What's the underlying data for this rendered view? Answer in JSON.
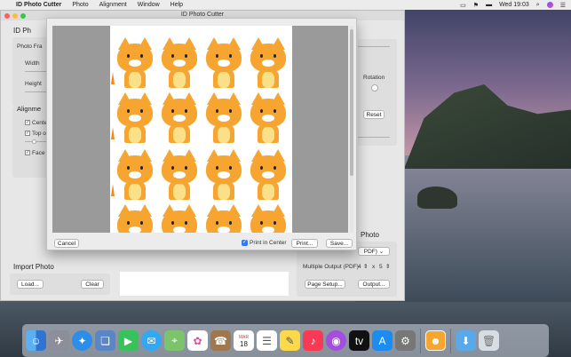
{
  "menubar": {
    "apple": "",
    "app_name": "ID Photo Cutter",
    "items": [
      "Photo",
      "Alignment",
      "Window",
      "Help"
    ],
    "clock": "Wed 19:03"
  },
  "window": {
    "title": "ID Photo Cutter",
    "left_title": "ID Ph",
    "photo_frame": "Photo Fra",
    "width_label": "Width",
    "height_label": "Height",
    "alignment": "Alignme",
    "align_center": "Cente",
    "align_top": "Top o",
    "align_face": "Face",
    "import_photo": "Import Photo",
    "load_button": "Load...",
    "clear_button": "Clear",
    "rotation_label": "Rotation",
    "reset_button": "Reset",
    "right_section": "Photo",
    "pdf_select": "PDF)",
    "multiple_output_label": "Multiple Output (PDF)",
    "multiple_rows": "4",
    "multiple_x": "x",
    "multiple_cols": "5",
    "page_setup_button": "Page Setup...",
    "output_button": "Output..."
  },
  "sheet": {
    "cancel_button": "Cancel",
    "print_in_center_label": "Print in Center",
    "print_in_center_checked": true,
    "print_button": "Print...",
    "save_button": "Save..."
  },
  "colors": {
    "cat_orange": "#f7a531",
    "accent_blue": "#3478f6"
  },
  "dock": [
    "finder-icon",
    "launchpad-icon",
    "safari-icon",
    "preview-icon",
    "facetime-icon",
    "messages-icon",
    "maps-icon",
    "photos-icon",
    "contacts-icon",
    "calendar-icon",
    "reminders-icon",
    "notes-icon",
    "music-icon",
    "podcasts-icon",
    "tv-icon",
    "app-store-icon",
    "system-preferences-icon",
    "id-photo-cutter-icon",
    "downloads-icon",
    "trash-icon"
  ],
  "dock_calendar": {
    "month": "MAR",
    "day": "18"
  }
}
